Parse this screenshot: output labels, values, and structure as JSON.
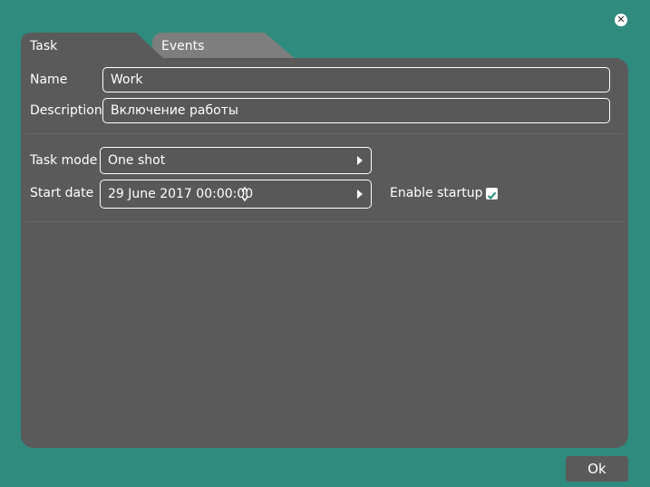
{
  "window": {
    "close_icon": "close-icon",
    "ok_label": "Ok"
  },
  "tabs": [
    {
      "label": "Task",
      "active": true
    },
    {
      "label": "Events",
      "active": false
    }
  ],
  "form": {
    "name_label": "Name",
    "name_value": "Work",
    "description_label": "Description",
    "description_value": "Включение работы",
    "task_mode_label": "Task mode",
    "task_mode_value": "One shot",
    "start_date_label": "Start date",
    "start_date_value": "29 June 2017 00:00:00",
    "enable_startup_label": "Enable startup",
    "enable_startup_checked": true
  },
  "colors": {
    "background": "#2e8b7d",
    "panel": "#5a5a5a",
    "inactive_tab": "#7e7e7e",
    "check_accent": "#2e8b7d"
  }
}
